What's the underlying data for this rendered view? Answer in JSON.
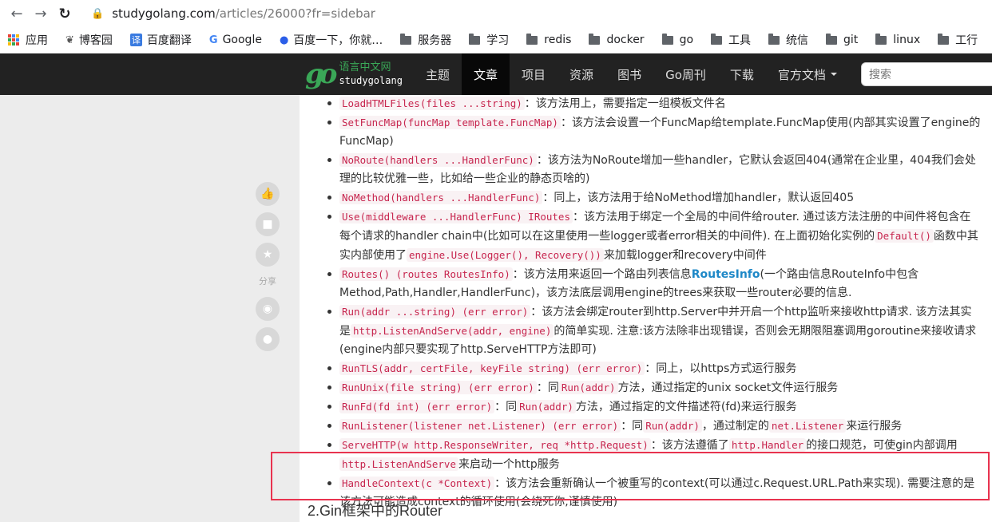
{
  "browser": {
    "url_host": "studygolang.com",
    "url_path": "/articles/26000?fr=sidebar",
    "bookmarks": [
      {
        "label": "应用",
        "icon": "apps-grid-icon"
      },
      {
        "label": "博客园",
        "icon": "cnblogs-icon"
      },
      {
        "label": "百度翻译",
        "icon": "translate-icon"
      },
      {
        "label": "Google",
        "icon": "google-icon"
      },
      {
        "label": "百度一下，你就…",
        "icon": "baidu-paw-icon"
      },
      {
        "label": "服务器",
        "icon": "folder-icon"
      },
      {
        "label": "学习",
        "icon": "folder-icon"
      },
      {
        "label": "redis",
        "icon": "folder-icon"
      },
      {
        "label": "docker",
        "icon": "folder-icon"
      },
      {
        "label": "go",
        "icon": "folder-icon"
      },
      {
        "label": "工具",
        "icon": "folder-icon"
      },
      {
        "label": "统信",
        "icon": "folder-icon"
      },
      {
        "label": "git",
        "icon": "folder-icon"
      },
      {
        "label": "linux",
        "icon": "folder-icon"
      },
      {
        "label": "工行",
        "icon": "folder-icon"
      }
    ]
  },
  "site": {
    "logo_cn": "语言中文网",
    "logo_en": "studygolang",
    "menu": [
      "主题",
      "文章",
      "项目",
      "资源",
      "图书",
      "Go周刊",
      "下载",
      "官方文档"
    ],
    "active_menu": "文章",
    "search_placeholder": "搜索"
  },
  "side": {
    "share_label": "分享",
    "tools": [
      "thumbs-up-icon",
      "comment-icon",
      "star-icon",
      "weibo-icon",
      "wechat-icon"
    ]
  },
  "items": [
    {
      "code": "LoadHTMLFiles(files ...string)",
      "t1": "：该方法用上，需要指定一组模板文件名"
    },
    {
      "code": "SetFuncMap(funcMap template.FuncMap)",
      "t1": "：该方法会设置一个FuncMap给template.FuncMap使用(内部其实设置了engine的FuncMap)"
    },
    {
      "code": "NoRoute(handlers ...HandlerFunc)",
      "t1": "：该方法为NoRoute增加一些handler，它默认会返回404(通常在企业里，404我们会处理的比较优雅一些，比如给一些企业的静态页啥的)"
    },
    {
      "code": "NoMethod(handlers ...HandlerFunc)",
      "t1": "：同上，该方法用于给NoMethod增加handler，默认返回405"
    },
    {
      "code": "Use(middleware ...HandlerFunc) IRoutes",
      "t1": "：该方法用于绑定一个全局的中间件给router. 通过该方法注册的中间件将包含在每个请求的handler chain中(比如可以在这里使用一些logger或者error相关的中间件). 在上面初始化实例的",
      "code2": "Default()",
      "t2": "函数中其实内部使用了",
      "code3": "engine.Use(Logger(), Recovery())",
      "t3": "来加载logger和recovery中间件"
    },
    {
      "code": "Routes() (routes RoutesInfo)",
      "t1": "：该方法用来返回一个路由列表信息",
      "link": "RoutesInfo",
      "t2": "(一个路由信息RouteInfo中包含Method,Path,Handler,HandlerFunc)，该方法底层调用engine的trees来获取一些router必要的信息."
    },
    {
      "code": "Run(addr ...string) (err error)",
      "t1": "：该方法会绑定router到http.Server中并开启一个http监听来接收http请求. 该方法其实是",
      "code2": "http.ListenAndServe(addr, engine)",
      "t2": "的简单实现. 注意:该方法除非出现错误，否则会无期限阻塞调用goroutine来接收请求(engine内部只要实现了http.ServeHTTP方法即可)"
    },
    {
      "code": "RunTLS(addr, certFile, keyFile string) (err error)",
      "t1": "：同上，以https方式运行服务"
    },
    {
      "code": "RunUnix(file string) (err error)",
      "t1": "：同",
      "code2": "Run(addr)",
      "t2": "方法，通过指定的unix socket文件运行服务"
    },
    {
      "code": "RunFd(fd int) (err error)",
      "t1": "：同",
      "code2": "Run(addr)",
      "t2": "方法，通过指定的文件描述符(fd)来运行服务"
    },
    {
      "code": "RunListener(listener net.Listener) (err error)",
      "t1": "：同",
      "code2": "Run(addr)",
      "t2": "，通过制定的",
      "code3": "net.Listener",
      "t3": "来运行服务"
    },
    {
      "code": "ServeHTTP(w http.ResponseWriter, req *http.Request)",
      "t1": "：该方法遵循了",
      "code2": "http.Handler",
      "t2": "的接口规范，可使gin内部调用",
      "code3": "http.ListenAndServe",
      "t3": "来启动一个http服务"
    },
    {
      "code": "HandleContext(c *Context)",
      "t1": "：该方法会重新确认一个被重写的context(可以通过c.Request.URL.Path来实现). 需要注意的是该方法可能造成context的循环使用(会绕死你,谨慎使用)"
    }
  ],
  "section_title": "2.Gin框架中的Router"
}
